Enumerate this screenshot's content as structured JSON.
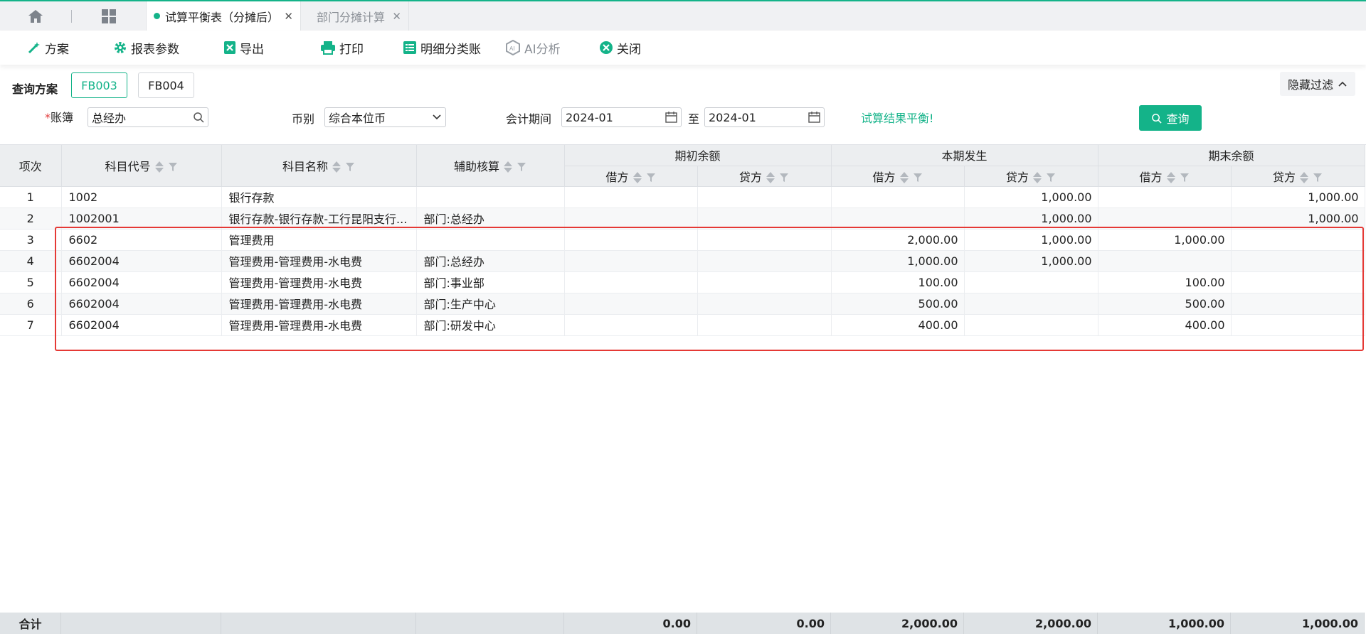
{
  "tabs": [
    {
      "label": "试算平衡表（分摊后）",
      "active": true
    },
    {
      "label": "部门分摊计算",
      "active": false
    }
  ],
  "toolbar": {
    "scheme": "方案",
    "params": "报表参数",
    "export": "导出",
    "print": "打印",
    "ledger": "明细分类账",
    "ai": "AI分析",
    "close": "关闭"
  },
  "query": {
    "scheme_label": "查询方案",
    "schemes": [
      "FB003",
      "FB004"
    ],
    "hide_filter": "隐藏过滤",
    "book_label": "账簿",
    "book_required": "*",
    "book_value": "总经办",
    "currency_label": "币别",
    "currency_value": "综合本位币",
    "period_label": "会计期间",
    "period_from": "2024-01",
    "period_to_label": "至",
    "period_to": "2024-01",
    "balance_msg": "试算结果平衡!",
    "query_btn": "查询"
  },
  "table": {
    "headers": {
      "index": "项次",
      "code": "科目代号",
      "name": "科目名称",
      "aux": "辅助核算",
      "opening": "期初余额",
      "current": "本期发生",
      "closing": "期末余额",
      "debit": "借方",
      "credit": "贷方"
    },
    "rows": [
      [
        "1",
        "1002",
        "银行存款",
        "",
        "",
        "",
        "",
        "1,000.00",
        "",
        "1,000.00"
      ],
      [
        "2",
        "1002001",
        "银行存款-银行存款-工行昆阳支行...",
        "部门:总经办",
        "",
        "",
        "",
        "1,000.00",
        "",
        "1,000.00"
      ],
      [
        "3",
        "6602",
        "管理费用",
        "",
        "",
        "",
        "2,000.00",
        "1,000.00",
        "1,000.00",
        ""
      ],
      [
        "4",
        "6602004",
        "管理费用-管理费用-水电费",
        "部门:总经办",
        "",
        "",
        "1,000.00",
        "1,000.00",
        "",
        ""
      ],
      [
        "5",
        "6602004",
        "管理费用-管理费用-水电费",
        "部门:事业部",
        "",
        "",
        "100.00",
        "",
        "100.00",
        ""
      ],
      [
        "6",
        "6602004",
        "管理费用-管理费用-水电费",
        "部门:生产中心",
        "",
        "",
        "500.00",
        "",
        "500.00",
        ""
      ],
      [
        "7",
        "6602004",
        "管理费用-管理费用-水电费",
        "部门:研发中心",
        "",
        "",
        "400.00",
        "",
        "400.00",
        ""
      ]
    ],
    "total": {
      "label": "合计",
      "values": [
        "0.00",
        "0.00",
        "2,000.00",
        "2,000.00",
        "1,000.00",
        "1,000.00"
      ]
    }
  },
  "colors": {
    "accent": "#14b389",
    "highlight": "#e53935"
  }
}
